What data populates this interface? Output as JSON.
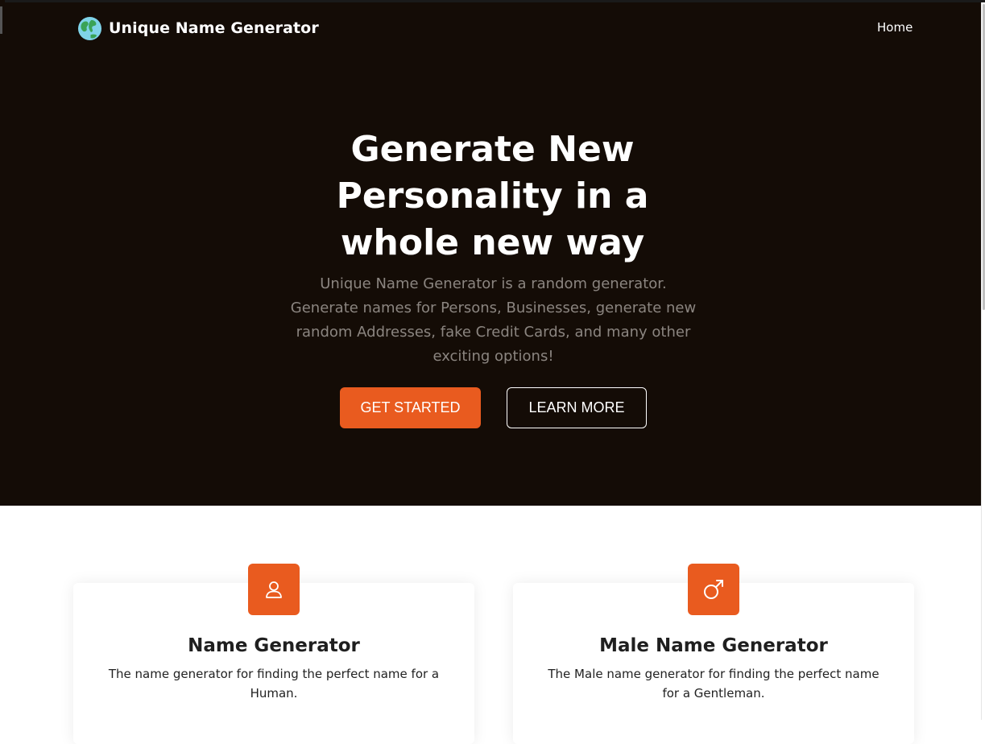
{
  "nav": {
    "brand": "Unique Name Generator",
    "brand_icon": "globe-icon",
    "home_label": "Home"
  },
  "hero": {
    "title": "Generate New Personality in a whole new way",
    "subtitle": "Unique Name Generator is a random generator. Generate names for Persons, Businesses, generate new random Addresses, fake Credit Cards, and many other exciting options!",
    "primary_button": "GET STARTED",
    "secondary_button": "LEARN MORE"
  },
  "features": [
    {
      "icon": "user-icon",
      "title": "Name Generator",
      "description": "The name generator for finding the perfect name for a Human."
    },
    {
      "icon": "male-symbol-icon",
      "title": "Male Name Generator",
      "description": "The Male name generator for finding the perfect name for a Gentleman."
    }
  ],
  "colors": {
    "hero_background": "#140c06",
    "accent": "#e95b1f",
    "subtitle_text": "#8b8580"
  }
}
